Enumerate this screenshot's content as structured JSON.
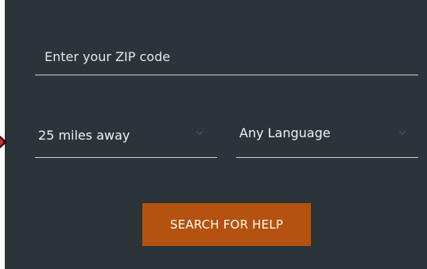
{
  "search_form": {
    "zip_placeholder": "Enter your ZIP code",
    "zip_value": "",
    "distance_selected": "25 miles away",
    "language_selected": "Any Language",
    "submit_label": "SEARCH FOR HELP"
  },
  "colors": {
    "panel_background": "#2b3439",
    "button_background": "#b5520f",
    "underline": "#cfd3d6",
    "text": "#f0f1f2"
  },
  "icons": {
    "dropdown": "chevron-down-icon",
    "marker": "triangle-right-icon"
  }
}
